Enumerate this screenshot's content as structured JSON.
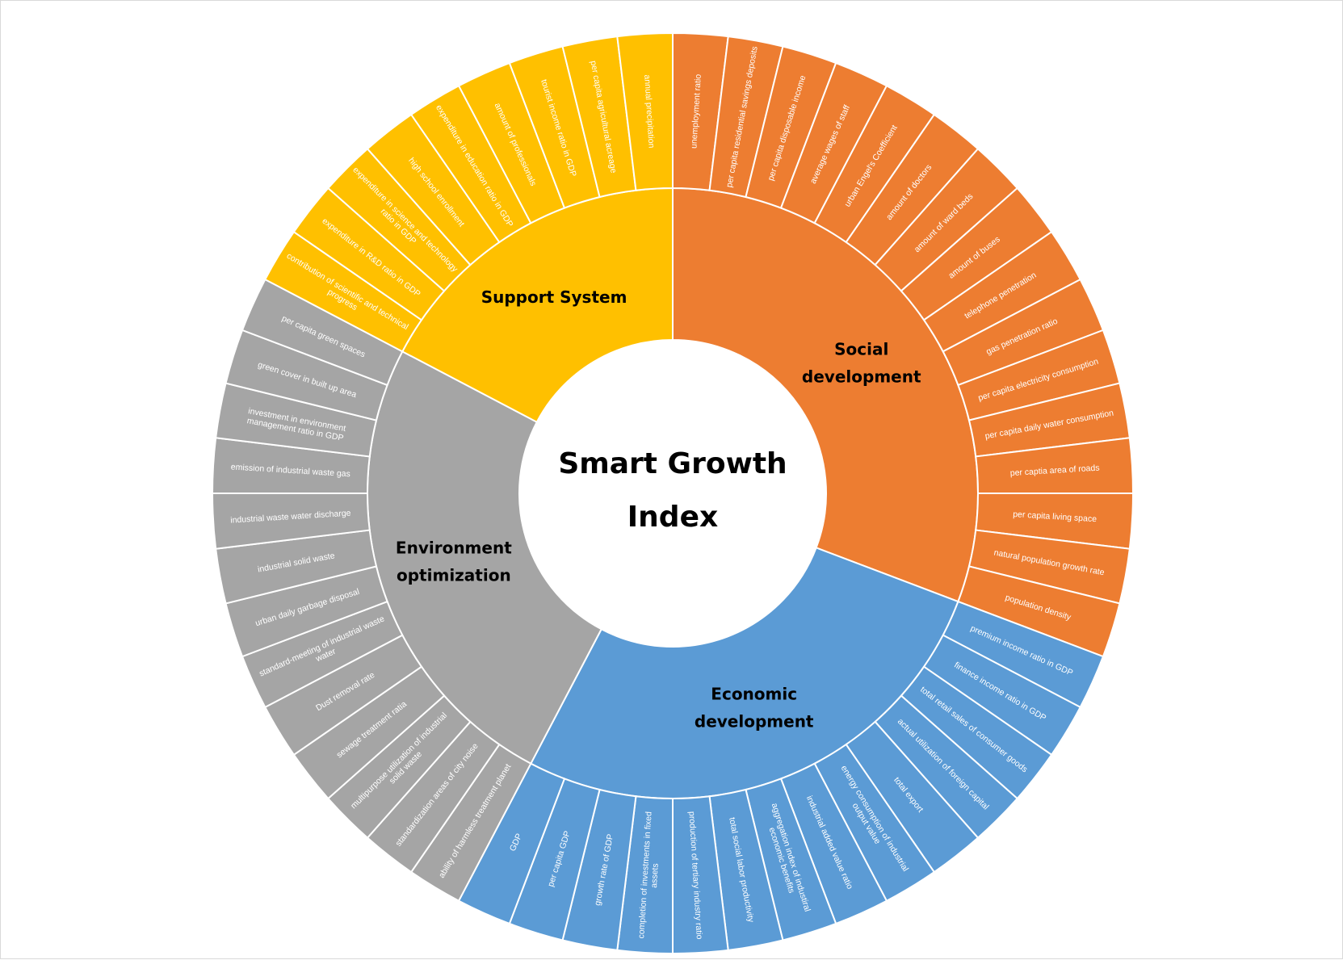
{
  "chart_data": {
    "type": "sunburst",
    "center": {
      "lines": [
        "Smart Growth",
        "Index"
      ]
    },
    "colors": {
      "Social development": "#ED7D31",
      "Economic development": "#5B9BD5",
      "Environment optimization": "#A5A5A5",
      "Support System": "#FFC000"
    },
    "groups": [
      {
        "name": "Social development",
        "lines": [
          "Social",
          "development"
        ],
        "children": [
          [
            "unemployment ratio"
          ],
          [
            "per capita residential savings deposits"
          ],
          [
            "per capita disposable income"
          ],
          [
            "average wages of staff"
          ],
          [
            "urban Engel's Coefficient"
          ],
          [
            "amount of doctors"
          ],
          [
            "amount of ward beds"
          ],
          [
            "amount of buses"
          ],
          [
            "telephone penetration"
          ],
          [
            "gas penetration ratio"
          ],
          [
            "per capita electricity consumption"
          ],
          [
            "per capita daily water consumption"
          ],
          [
            "per captia area of roads"
          ],
          [
            "per capita living space"
          ],
          [
            "natural population growth rate"
          ],
          [
            "population density"
          ]
        ]
      },
      {
        "name": "Economic development",
        "lines": [
          "Economic",
          "development"
        ],
        "children": [
          [
            "premium income ratio in GDP"
          ],
          [
            "finance income ratio in GDP"
          ],
          [
            "total retail sales of consumer goods"
          ],
          [
            "actual utilization of foreign capital"
          ],
          [
            "total export"
          ],
          [
            "energy consumption of industrial",
            "output value"
          ],
          [
            "industrial added value ratio"
          ],
          [
            "aggregation index of industiral",
            "economic benefits"
          ],
          [
            "total social labor productivity"
          ],
          [
            "production of tertiary industry ratio"
          ],
          [
            "completion of investments in fixed",
            "assets"
          ],
          [
            "growth rate of GDP"
          ],
          [
            "per capita GDP"
          ],
          [
            "GDP"
          ]
        ]
      },
      {
        "name": "Environment optimization",
        "lines": [
          "Environment",
          "optimization"
        ],
        "children": [
          [
            "ability of harmless treatment planet"
          ],
          [
            "standardization areas of city noise"
          ],
          [
            "multipurpose utilization of industrial",
            "solid waste"
          ],
          [
            "sewage treatment ratia"
          ],
          [
            "Dust removal rate"
          ],
          [
            "standard-meeting of industrial waste",
            "water"
          ],
          [
            "urban daily garbage disposal"
          ],
          [
            "industrial solid waste"
          ],
          [
            "industrial waste water discharge"
          ],
          [
            "emission of industrial waste gas"
          ],
          [
            "investment in environment",
            "management ratio in GDP"
          ],
          [
            "green cover in built up area"
          ],
          [
            "per capita green spaces"
          ]
        ]
      },
      {
        "name": "Support System",
        "lines": [
          "Support System"
        ],
        "children": [
          [
            "contribution of scientific and technical",
            "progress"
          ],
          [
            "expenditure in R&D ratio in GDP"
          ],
          [
            "expenditure in science and technology",
            "ratio in GDP"
          ],
          [
            "high school enrollment"
          ],
          [
            "expenditure in education ratio in GDP"
          ],
          [
            "amount of professionals"
          ],
          [
            "tourist income ratio in GDP"
          ],
          [
            "per capita agricultural acreage"
          ],
          [
            "annual precipitation"
          ]
        ]
      }
    ]
  }
}
